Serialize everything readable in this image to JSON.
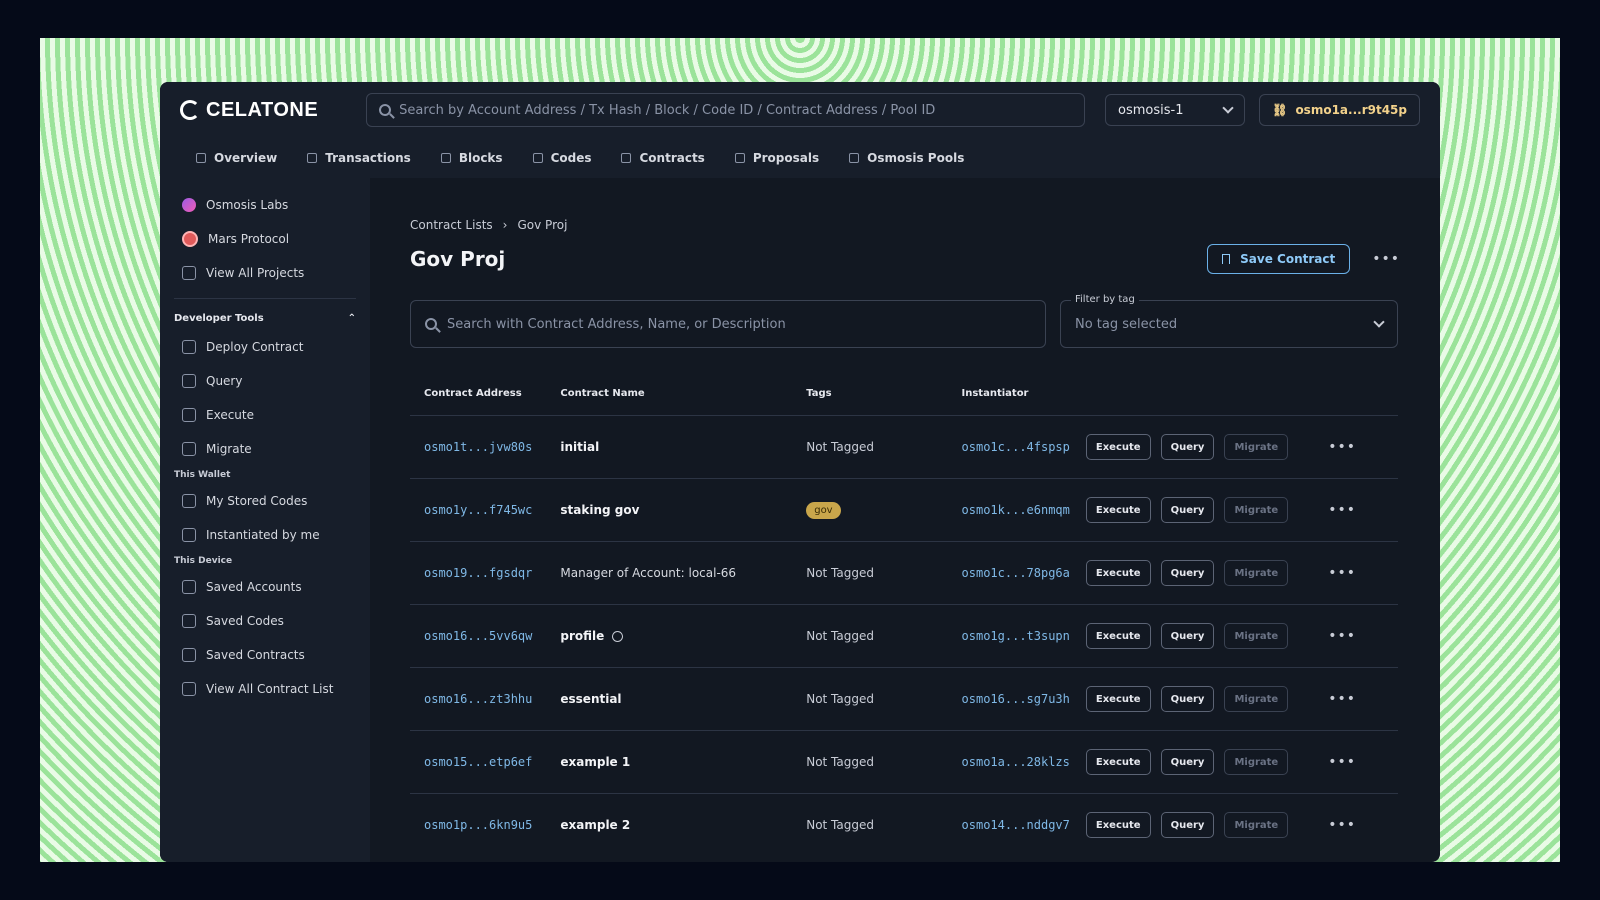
{
  "app": {
    "logo": "CELATONE"
  },
  "header": {
    "search_placeholder": "Search by Account Address / Tx Hash / Block / Code ID / Contract Address / Pool ID",
    "network": "osmosis-1",
    "wallet": "osmo1a...r9t45p"
  },
  "nav": [
    {
      "label": "Overview",
      "icon": "home-icon"
    },
    {
      "label": "Transactions",
      "icon": "document-icon"
    },
    {
      "label": "Blocks",
      "icon": "block-icon"
    },
    {
      "label": "Codes",
      "icon": "code-icon"
    },
    {
      "label": "Contracts",
      "icon": "contract-icon"
    },
    {
      "label": "Proposals",
      "icon": "proposal-icon"
    },
    {
      "label": "Osmosis Pools",
      "icon": "pool-icon"
    }
  ],
  "sidebar": {
    "projects": [
      "Osmosis Labs",
      "Mars Protocol",
      "View All Projects"
    ],
    "developer_tools_heading": "Developer Tools",
    "developer_tools": [
      "Deploy Contract",
      "Query",
      "Execute",
      "Migrate"
    ],
    "this_wallet_heading": "This Wallet",
    "this_wallet": [
      "My Stored Codes",
      "Instantiated by me"
    ],
    "this_device_heading": "This Device",
    "this_device": [
      "Saved Accounts",
      "Saved Codes",
      "Saved Contracts",
      "View All Contract List"
    ]
  },
  "main": {
    "breadcrumb": [
      "Contract Lists",
      "Gov Proj"
    ],
    "title": "Gov Proj",
    "save_button": "Save Contract",
    "search_placeholder": "Search with Contract Address, Name, or Description",
    "filter_label": "Filter by tag",
    "filter_value": "No tag selected",
    "columns": [
      "Contract Address",
      "Contract Name",
      "Tags",
      "Instantiator"
    ],
    "action_labels": {
      "execute": "Execute",
      "query": "Query",
      "migrate": "Migrate"
    },
    "rows": [
      {
        "address": "osmo1t...jvw80s",
        "name": "initial",
        "tag": "Not Tagged",
        "instantiator": "osmo1c...4fspsp"
      },
      {
        "address": "osmo1y...f745wc",
        "name": "staking gov",
        "tag": "gov",
        "instantiator": "osmo1k...e6nmqm"
      },
      {
        "address": "osmo19...fgsdqr",
        "name": "Manager of Account: local-66",
        "tag": "Not Tagged",
        "instantiator": "osmo1c...78pg6a"
      },
      {
        "address": "osmo16...5vv6qw",
        "name": "profile",
        "tag": "Not Tagged",
        "instantiator": "osmo1g...t3supn"
      },
      {
        "address": "osmo16...zt3hhu",
        "name": "essential",
        "tag": "Not Tagged",
        "instantiator": "osmo16...sg7u3h"
      },
      {
        "address": "osmo15...etp6ef",
        "name": "example 1",
        "tag": "Not Tagged",
        "instantiator": "osmo1a...28klzs"
      },
      {
        "address": "osmo1p...6kn9u5",
        "name": "example 2",
        "tag": "Not Tagged",
        "instantiator": "osmo14...nddgv7"
      }
    ]
  }
}
